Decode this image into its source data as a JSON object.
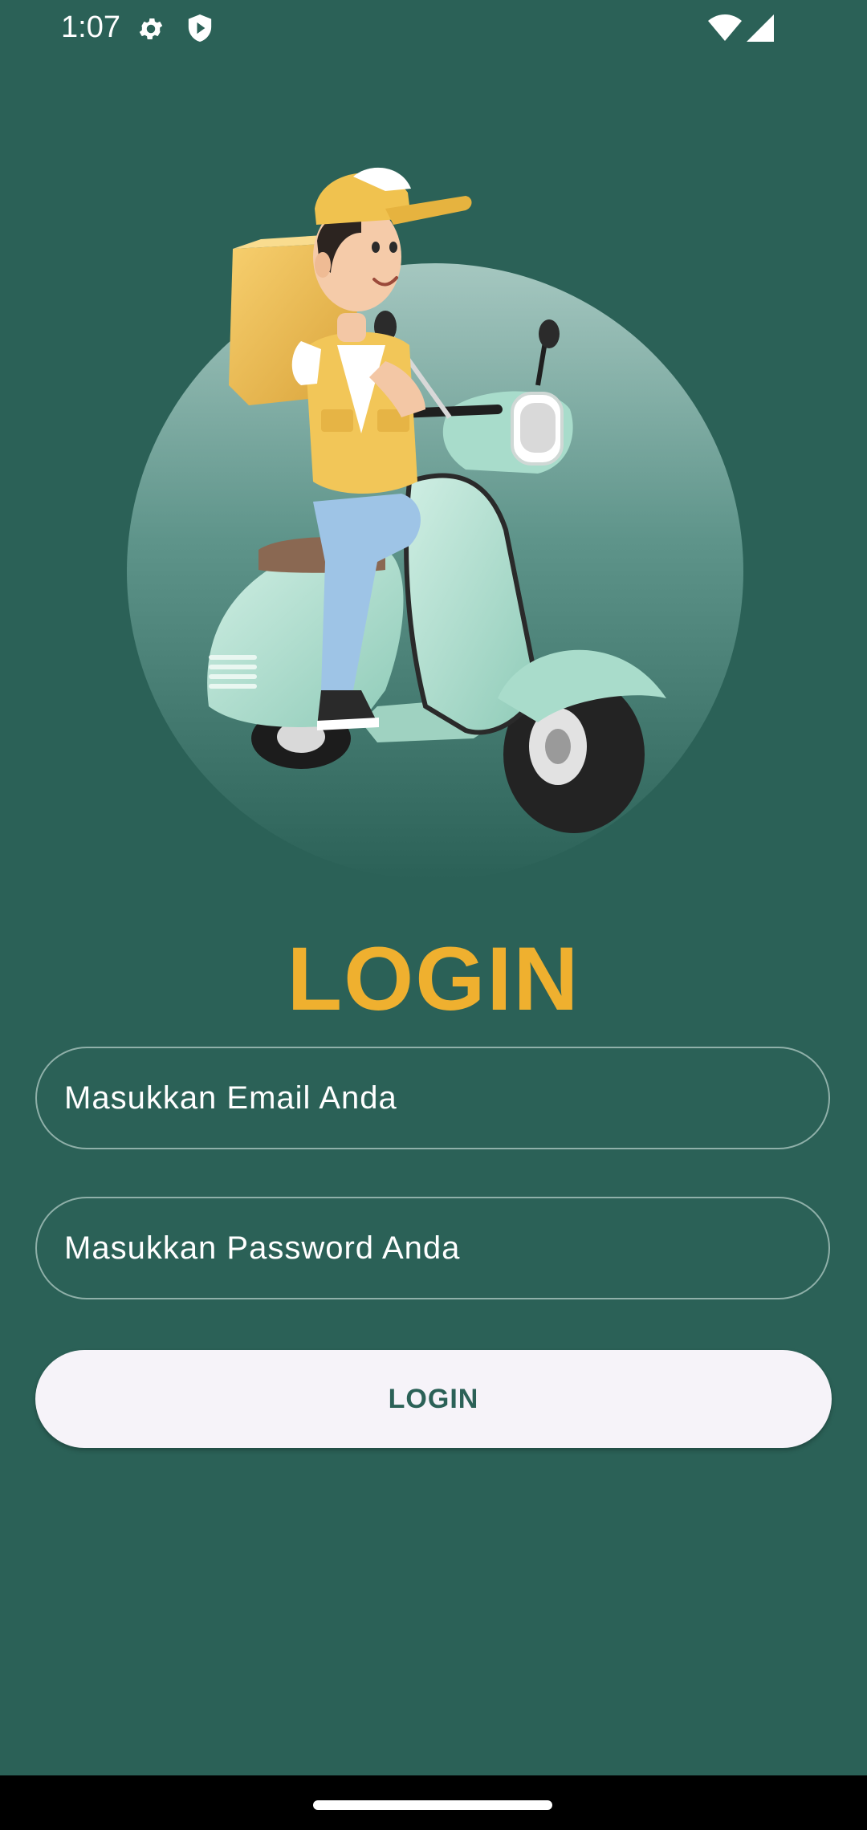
{
  "status_bar": {
    "time": "1:07",
    "icons": [
      "gear-icon",
      "shield-icon",
      "wifi-icon",
      "signal-icon"
    ]
  },
  "hero": {
    "illustration": "delivery-rider-on-scooter"
  },
  "login": {
    "title": "LOGIN",
    "email_placeholder": "Masukkan Email Anda",
    "password_placeholder": "Masukkan Password Anda",
    "button_label": "LOGIN"
  },
  "colors": {
    "background": "#2b6157",
    "accent": "#efb02f",
    "button_bg": "#f6f3f9",
    "button_text": "#2b6157"
  }
}
